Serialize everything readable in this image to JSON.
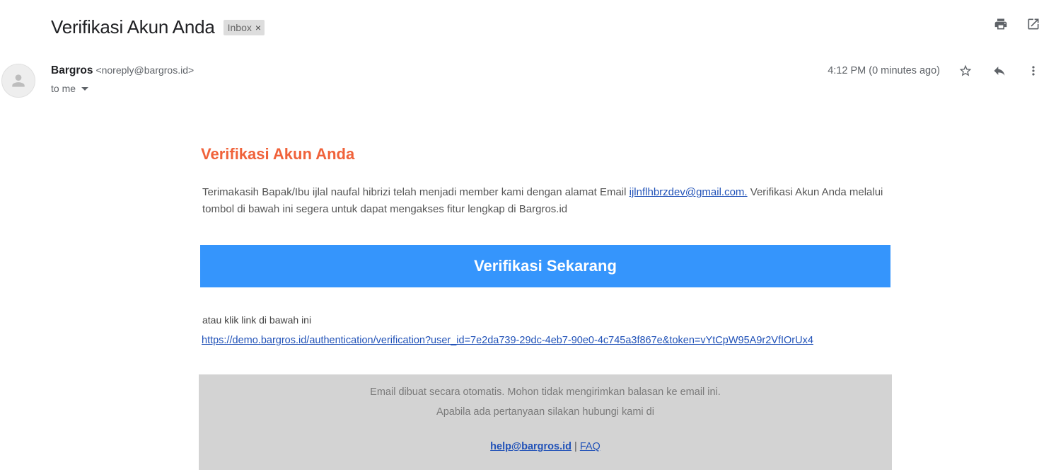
{
  "header": {
    "subject": "Verifikasi Akun Anda",
    "label": "Inbox",
    "label_remove": "×",
    "actions": [
      "print-icon",
      "open-in-new-window-icon"
    ]
  },
  "message": {
    "sender_name": "Bargros",
    "sender_email": "<noreply@bargros.id>",
    "recipient": "to me",
    "timestamp": "4:12 PM (0 minutes ago)",
    "actions": [
      "star-icon",
      "reply-icon",
      "more-vert-icon"
    ]
  },
  "body": {
    "title": "Verifikasi Akun Anda",
    "paragraph_before": "Terimakasih Bapak/Ibu ijlal naufal hibrizi telah menjadi member kami dengan alamat Email ",
    "email_link": "ijlnflhbrzdev@gmail.com.",
    "paragraph_after": " Verifikasi Akun Anda melalui tombol di bawah ini segera untuk dapat mengakses fitur lengkap di Bargros.id",
    "button_label": "Verifikasi Sekarang",
    "alt_text": "atau klik link di bawah ini",
    "verification_link": "https://demo.bargros.id/authentication/verification?user_id=7e2da739-29dc-4eb7-90e0-4c745a3f867e&token=vYtCpW95A9r2VfIOrUx4"
  },
  "footer": {
    "line1": "Email dibuat secara otomatis. Mohon tidak mengirimkan balasan ke email ini.",
    "line2": "Apabila ada pertanyaan silakan hubungi kami di",
    "help_email": "help@bargros.id",
    "separator": "|",
    "faq": "FAQ"
  },
  "colors": {
    "title": "#f0623a",
    "button": "#3595fc",
    "link": "#2152b8",
    "footer_bg": "#d3d3d3"
  }
}
